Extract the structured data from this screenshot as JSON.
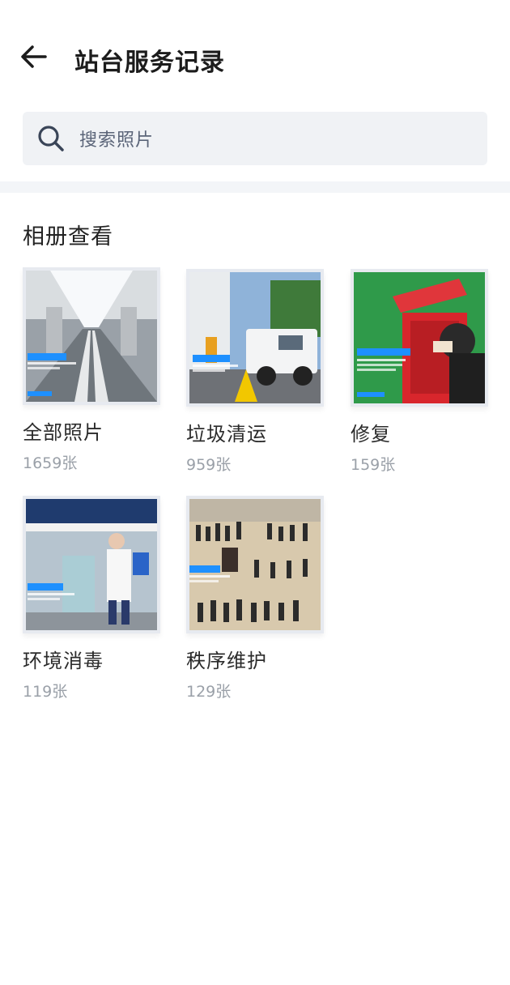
{
  "header": {
    "title": "站台服务记录",
    "back_icon": "arrow-left-icon"
  },
  "search": {
    "placeholder": "搜索照片",
    "icon": "search-icon"
  },
  "section": {
    "title": "相册查看"
  },
  "albums": [
    {
      "name": "全部照片",
      "count": "1659张"
    },
    {
      "name": "垃圾清运",
      "count": "959张"
    },
    {
      "name": "修复",
      "count": "159张"
    },
    {
      "name": "环境消毒",
      "count": "119张"
    },
    {
      "name": "秩序维护",
      "count": "129张"
    }
  ],
  "colors": {
    "watermark_blue": "#1e90ff",
    "fire_box_red": "#d8262c",
    "grass_green": "#2f9a4a"
  }
}
